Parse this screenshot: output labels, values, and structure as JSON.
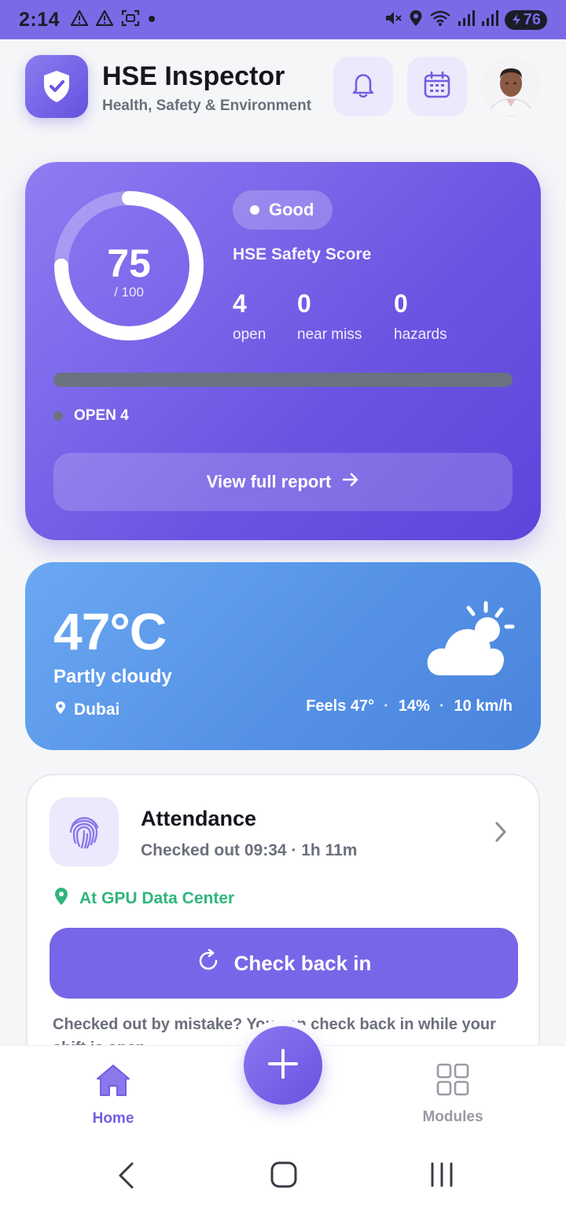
{
  "status_bar": {
    "time": "2:14",
    "battery": "76",
    "icons": [
      "warning-icon",
      "warning-icon",
      "screenshot-icon",
      "dot-icon",
      "mute-icon",
      "location-icon",
      "wifi-icon",
      "signal-icon",
      "signal-icon",
      "battery-icon"
    ]
  },
  "header": {
    "title": "HSE Inspector",
    "subtitle": "Health, Safety & Environment",
    "icons": [
      "shield-check-icon",
      "bell-icon",
      "calendar-icon"
    ]
  },
  "score_card": {
    "score": "75",
    "score_max": "/ 100",
    "score_fraction": 0.75,
    "badge": "Good",
    "label": "HSE Safety Score",
    "stats": [
      {
        "value": "4",
        "label": "open"
      },
      {
        "value": "0",
        "label": "near miss"
      },
      {
        "value": "0",
        "label": "hazards"
      }
    ],
    "legend": "OPEN 4",
    "report_button": "View full report",
    "colors": {
      "card": "#6f5ae4",
      "bar_open": "#6b7280"
    }
  },
  "weather": {
    "temperature": "47°C",
    "condition": "Partly cloudy",
    "city": "Dubai",
    "feels": "Feels 47°",
    "humidity": "14%",
    "wind": "10 km/h",
    "separator": "·",
    "icon": "partly-cloudy-icon"
  },
  "attendance": {
    "title": "Attendance",
    "subtitle": "Checked out 09:34 · 1h 11m",
    "location": "At GPU Data Center",
    "button": "Check back in",
    "hint": "Checked out by mistake? You can check back in while your shift is open."
  },
  "bottom_nav": {
    "home": "Home",
    "modules": "Modules"
  },
  "colors": {
    "accent": "#7866e8",
    "success": "#2fb67c",
    "weather": "#5a96e8"
  }
}
